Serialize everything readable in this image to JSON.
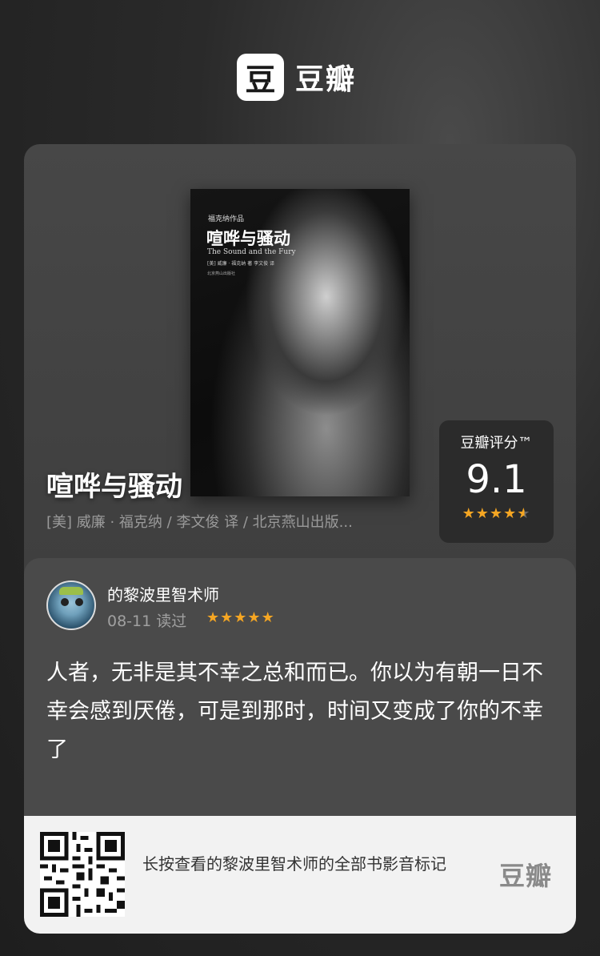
{
  "brand": {
    "logo_char": "豆",
    "name": "豆瓣"
  },
  "book": {
    "cover": {
      "series": "福克纳作品",
      "title": "喧哗与骚动",
      "english_title": "The Sound and the Fury",
      "author_line": "[美] 威廉 · 福克纳 著   李文俊 译",
      "publisher": "北京燕山出版社"
    },
    "title": "喧哗与骚动",
    "meta": "[美] 威廉 · 福克纳 / 李文俊 译 / 北京燕山出版..."
  },
  "rating": {
    "label": "豆瓣评分™",
    "score": "9.1",
    "stars": 4.5
  },
  "review": {
    "reviewer": "的黎波里智术师",
    "date_status": "08-11 读过",
    "stars": 5,
    "text": "人者，无非是其不幸之总和而已。你以为有朝一日不幸会感到厌倦，可是到那时，时间又变成了你的不幸了"
  },
  "footer": {
    "text": "长按查看的黎波里智术师的全部书影音标记",
    "logo": "豆瓣"
  },
  "colors": {
    "accent_star": "#f5a623",
    "background": "#2a2a2a"
  }
}
